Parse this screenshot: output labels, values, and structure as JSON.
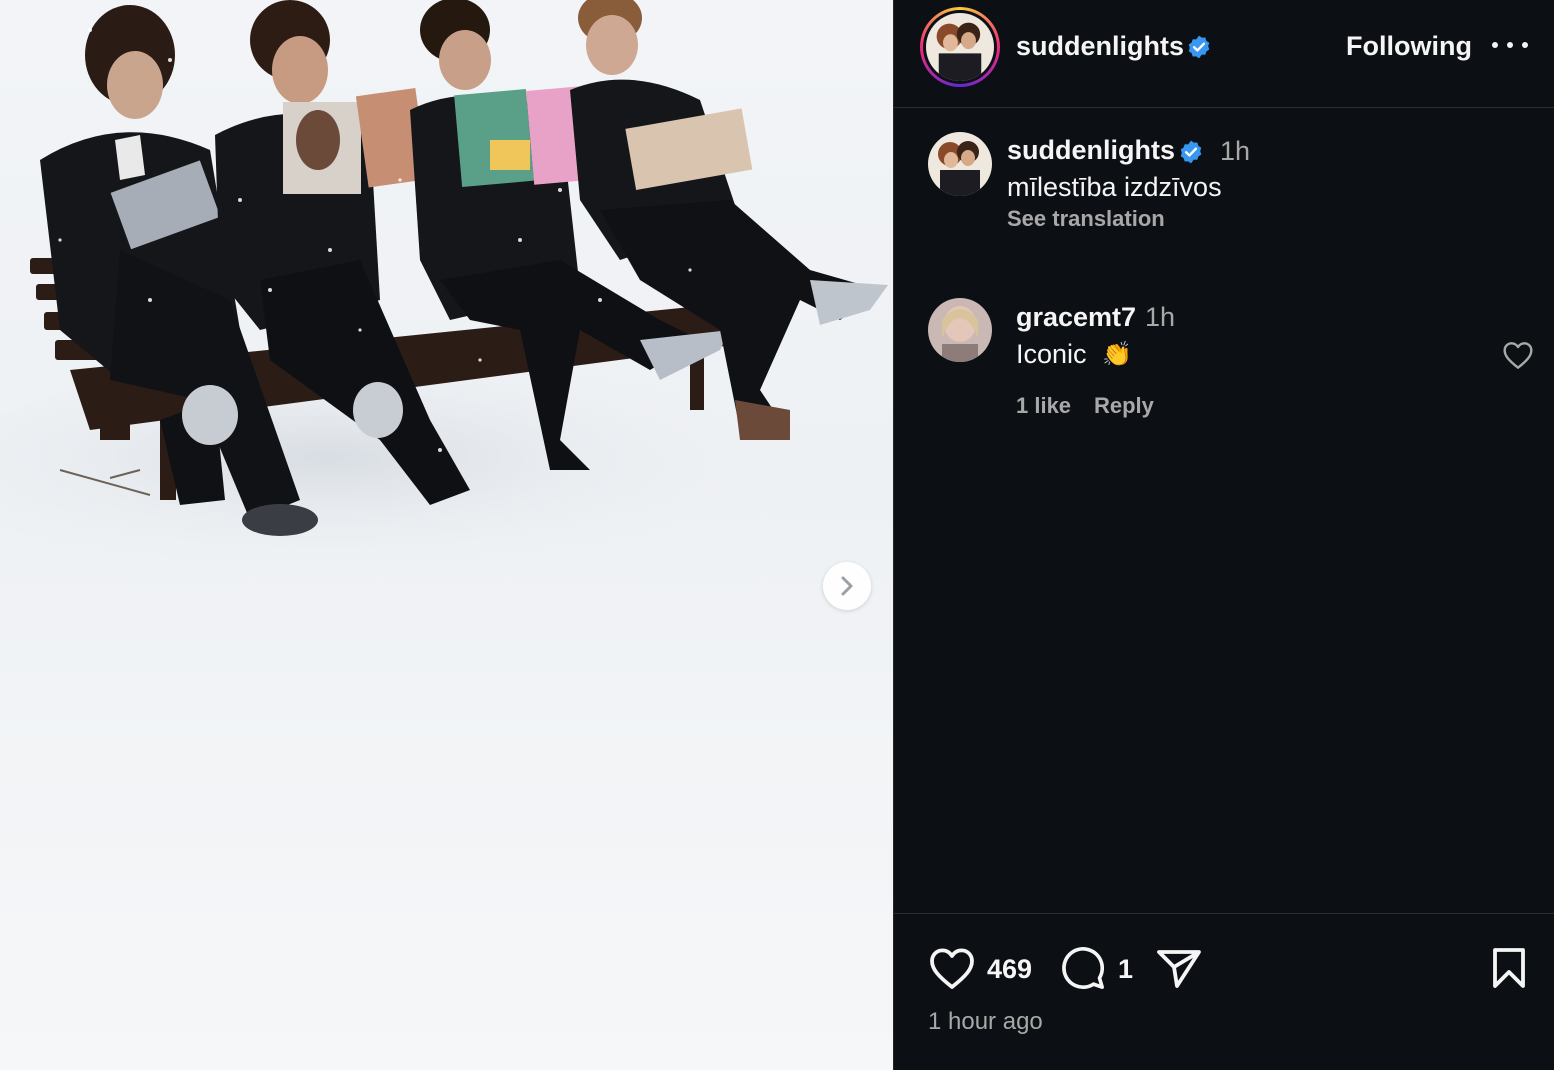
{
  "post": {
    "username": "suddenlights",
    "follow_status": "Following",
    "more_label": "More options",
    "image_alt": "Four men in dark suits sitting on a bench in the snow reading magazines"
  },
  "caption": {
    "username": "suddenlights",
    "time": "1h",
    "text": "mīlestība izdzīvos",
    "see_translation": "See translation"
  },
  "comments": [
    {
      "username": "gracemt7",
      "time": "1h",
      "text": "Iconic",
      "emoji": "👏",
      "likes": "1 like",
      "reply_label": "Reply"
    }
  ],
  "actions": {
    "like_count": "469",
    "comment_count": "1",
    "timestamp": "1 hour ago"
  },
  "icons": {
    "verified": "verified-badge-icon",
    "like": "heart-icon",
    "comment": "comment-bubble-icon",
    "share": "paper-plane-icon",
    "save": "bookmark-icon",
    "next": "chevron-right-icon",
    "more": "ellipsis-icon"
  },
  "colors": {
    "background": "#0c0f14",
    "text": "#f5f5f5",
    "secondary_text": "#a8a8a8",
    "verified": "#3897f0"
  }
}
